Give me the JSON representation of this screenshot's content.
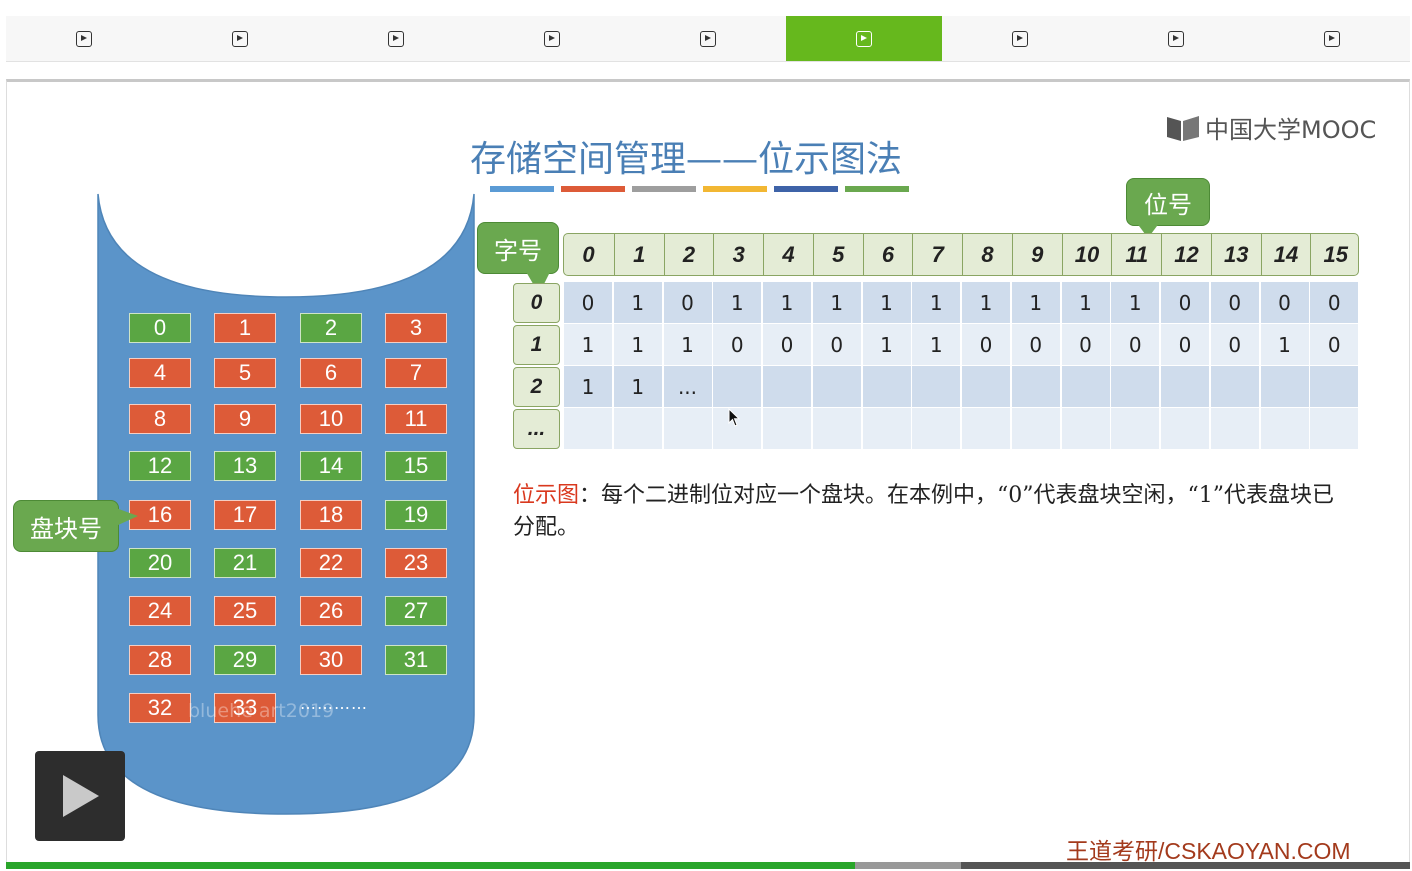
{
  "player": {
    "segments": [
      {
        "icon": "play-square-icon",
        "active": false
      },
      {
        "icon": "play-square-icon",
        "active": false
      },
      {
        "icon": "play-square-icon",
        "active": false
      },
      {
        "icon": "play-square-icon",
        "active": false
      },
      {
        "icon": "play-square-icon",
        "active": false
      },
      {
        "icon": "play-square-icon",
        "active": true
      },
      {
        "icon": "play-square-icon",
        "active": false
      },
      {
        "icon": "play-square-icon",
        "active": false
      },
      {
        "icon": "play-square-icon",
        "active": false
      }
    ],
    "accent_color": "#66b81d",
    "progress_fraction": 0.605,
    "buffered_fraction": 0.68
  },
  "slide": {
    "title": "存储空间管理——位示图法",
    "title_bar_colors": [
      "#5b9bd5",
      "#dd5b38",
      "#9e9e9e",
      "#f2b733",
      "#3e63a8",
      "#6aa84f"
    ],
    "logo_text": "中国大学MOOC",
    "disk": {
      "blocks": [
        {
          "n": "0",
          "status": "allocated"
        },
        {
          "n": "1",
          "status": "free"
        },
        {
          "n": "2",
          "status": "allocated"
        },
        {
          "n": "3",
          "status": "free"
        },
        {
          "n": "4",
          "status": "free"
        },
        {
          "n": "5",
          "status": "free"
        },
        {
          "n": "6",
          "status": "free"
        },
        {
          "n": "7",
          "status": "free"
        },
        {
          "n": "8",
          "status": "free"
        },
        {
          "n": "9",
          "status": "free"
        },
        {
          "n": "10",
          "status": "free"
        },
        {
          "n": "11",
          "status": "free"
        },
        {
          "n": "12",
          "status": "allocated"
        },
        {
          "n": "13",
          "status": "allocated"
        },
        {
          "n": "14",
          "status": "allocated"
        },
        {
          "n": "15",
          "status": "allocated"
        },
        {
          "n": "16",
          "status": "free"
        },
        {
          "n": "17",
          "status": "free"
        },
        {
          "n": "18",
          "status": "free"
        },
        {
          "n": "19",
          "status": "allocated"
        },
        {
          "n": "20",
          "status": "allocated"
        },
        {
          "n": "21",
          "status": "allocated"
        },
        {
          "n": "22",
          "status": "free"
        },
        {
          "n": "23",
          "status": "free"
        },
        {
          "n": "24",
          "status": "free"
        },
        {
          "n": "25",
          "status": "free"
        },
        {
          "n": "26",
          "status": "free"
        },
        {
          "n": "27",
          "status": "allocated"
        },
        {
          "n": "28",
          "status": "free"
        },
        {
          "n": "29",
          "status": "allocated"
        },
        {
          "n": "30",
          "status": "free"
        },
        {
          "n": "31",
          "status": "allocated"
        },
        {
          "n": "32",
          "status": "free"
        },
        {
          "n": "33",
          "status": "free"
        }
      ],
      "free_color": "#dd5b38",
      "allocated_color": "#5aa643",
      "more": "…………",
      "watermark": "bluehe art2019"
    },
    "callouts": {
      "block_number": "盘块号",
      "word_number": "字号",
      "bit_number": "位号"
    },
    "bitmap": {
      "bit_headers": [
        "0",
        "1",
        "2",
        "3",
        "4",
        "5",
        "6",
        "7",
        "8",
        "9",
        "10",
        "11",
        "12",
        "13",
        "14",
        "15"
      ],
      "row_headers": [
        "0",
        "1",
        "2",
        "..."
      ],
      "rows": [
        [
          "0",
          "1",
          "0",
          "1",
          "1",
          "1",
          "1",
          "1",
          "1",
          "1",
          "1",
          "1",
          "0",
          "0",
          "0",
          "0"
        ],
        [
          "1",
          "1",
          "1",
          "0",
          "0",
          "0",
          "1",
          "1",
          "0",
          "0",
          "0",
          "0",
          "0",
          "0",
          "1",
          "0"
        ],
        [
          "1",
          "1",
          "...",
          "",
          "",
          "",
          "",
          "",
          "",
          "",
          "",
          "",
          "",
          "",
          "",
          ""
        ],
        [
          "",
          "",
          "",
          "",
          "",
          "",
          "",
          "",
          "",
          "",
          "",
          "",
          "",
          "",
          "",
          ""
        ]
      ]
    },
    "description": {
      "term": "位示图",
      "text": "：每个二进制位对应一个盘块。在本例中，“0”代表盘块空闲，“1”代表盘块已分配。"
    },
    "footer": "王道考研/CSKAOYAN.COM"
  }
}
